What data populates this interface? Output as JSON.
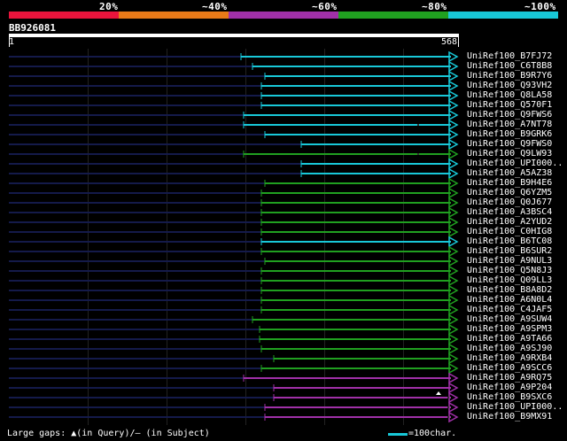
{
  "percent_labels": [
    "20%",
    "~40%",
    "~60%",
    "~80%",
    "~100%"
  ],
  "identity_bar": [
    {
      "name": "20%",
      "color": "#e8143c"
    },
    {
      "name": "40%",
      "color": "#e87a18"
    },
    {
      "name": "60%",
      "color": "#a030a8"
    },
    {
      "name": "80%",
      "color": "#20a020"
    },
    {
      "name": "100%",
      "color": "#18c8d8"
    }
  ],
  "query": {
    "name": "BB926081",
    "start": "1",
    "end": "568"
  },
  "hits": [
    {
      "label": "UniRef100_B7FJ72",
      "color": "#18c8d8",
      "start": 272,
      "marks": []
    },
    {
      "label": "UniRef100_C6T8B8",
      "color": "#18c8d8",
      "start": 285,
      "marks": []
    },
    {
      "label": "UniRef100_B9R7Y6",
      "color": "#18c8d8",
      "start": 299,
      "marks": []
    },
    {
      "label": "UniRef100_Q93VH2",
      "color": "#18c8d8",
      "start": 295,
      "marks": []
    },
    {
      "label": "UniRef100_Q8LA58",
      "color": "#18c8d8",
      "start": 295,
      "marks": []
    },
    {
      "label": "UniRef100_Q570F1",
      "color": "#18c8d8",
      "start": 295,
      "marks": []
    },
    {
      "label": "UniRef100_Q9FWS6",
      "color": "#18c8d8",
      "start": 275,
      "marks": []
    },
    {
      "label": "UniRef100_A7NT78",
      "color": "#18c8d8",
      "start": 275,
      "marks": [
        471
      ]
    },
    {
      "label": "UniRef100_B9GRK6",
      "color": "#18c8d8",
      "start": 299,
      "marks": [
        534
      ]
    },
    {
      "label": "UniRef100_Q9FWS0",
      "color": "#18c8d8",
      "start": 340,
      "marks": []
    },
    {
      "label": "UniRef100_Q9LW93",
      "color": "#20a020",
      "start": 275,
      "marks": [
        471
      ]
    },
    {
      "label": "UniRef100_UPI000..",
      "color": "#18c8d8",
      "start": 340,
      "marks": []
    },
    {
      "label": "UniRef100_A5AZ38",
      "color": "#18c8d8",
      "start": 340,
      "marks": []
    },
    {
      "label": "UniRef100_B9H4E6",
      "color": "#20a020",
      "start": 299,
      "marks": []
    },
    {
      "label": "UniRef100_Q6YZM5",
      "color": "#20a020",
      "start": 295,
      "marks": []
    },
    {
      "label": "UniRef100_Q0J677",
      "color": "#20a020",
      "start": 295,
      "marks": []
    },
    {
      "label": "UniRef100_A3BSC4",
      "color": "#20a020",
      "start": 295,
      "marks": []
    },
    {
      "label": "UniRef100_A2YUD2",
      "color": "#20a020",
      "start": 295,
      "marks": []
    },
    {
      "label": "UniRef100_C0HIG8",
      "color": "#20a020",
      "start": 295,
      "marks": []
    },
    {
      "label": "UniRef100_B6TC08",
      "color": "#18c8d8",
      "start": 295,
      "marks": []
    },
    {
      "label": "UniRef100_B6SUR2",
      "color": "#20a020",
      "start": 295,
      "marks": []
    },
    {
      "label": "UniRef100_A9NUL3",
      "color": "#20a020",
      "start": 299,
      "marks": []
    },
    {
      "label": "UniRef100_Q5N8J3",
      "color": "#20a020",
      "start": 295,
      "marks": [
        529
      ]
    },
    {
      "label": "UniRef100_Q09LL3",
      "color": "#20a020",
      "start": 295,
      "marks": [
        529
      ]
    },
    {
      "label": "UniRef100_B8A8D2",
      "color": "#20a020",
      "start": 295,
      "marks": [
        529
      ]
    },
    {
      "label": "UniRef100_A6N0L4",
      "color": "#20a020",
      "start": 295,
      "marks": [
        529
      ]
    },
    {
      "label": "UniRef100_C4JAF5",
      "color": "#20a020",
      "start": 295,
      "marks": [
        529
      ]
    },
    {
      "label": "UniRef100_A9SUW4",
      "color": "#20a020",
      "start": 285,
      "marks": []
    },
    {
      "label": "UniRef100_A9SPM3",
      "color": "#20a020",
      "start": 293,
      "marks": []
    },
    {
      "label": "UniRef100_A9TA66",
      "color": "#20a020",
      "start": 293,
      "marks": []
    },
    {
      "label": "UniRef100_A9SJ90",
      "color": "#20a020",
      "start": 295,
      "marks": []
    },
    {
      "label": "UniRef100_A9RXB4",
      "color": "#20a020",
      "start": 309,
      "marks": []
    },
    {
      "label": "UniRef100_A9SCC6",
      "color": "#20a020",
      "start": 295,
      "marks": []
    },
    {
      "label": "UniRef100_A9RQ75",
      "color": "#a030a8",
      "start": 275,
      "marks": []
    },
    {
      "label": "UniRef100_A9P204",
      "color": "#a030a8",
      "start": 309,
      "marks": []
    },
    {
      "label": "UniRef100_B9SXC6",
      "color": "#a030a8",
      "start": 309,
      "marks": [
        505
      ]
    },
    {
      "label": "UniRef100_UPI000..",
      "color": "#a030a8",
      "start": 299,
      "marks": [
        505
      ]
    },
    {
      "label": "UniRef100_B9MX91",
      "color": "#a030a8",
      "start": 299,
      "marks": [
        505
      ]
    }
  ],
  "footer": {
    "text": "Large gaps: ▲(in Query)/— (in Subject)",
    "legend_text": "=100char."
  }
}
